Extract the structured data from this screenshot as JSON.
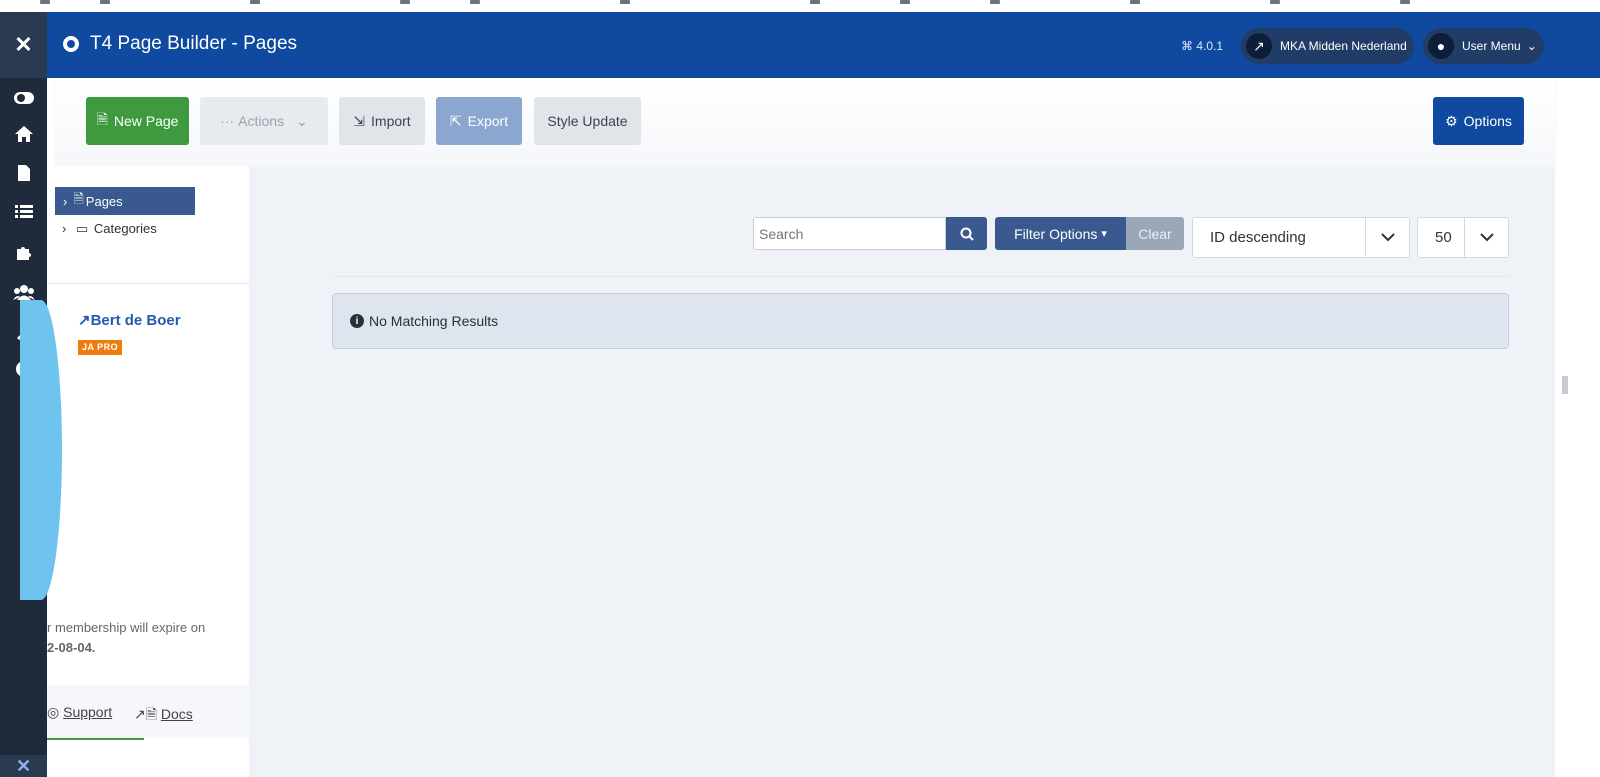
{
  "header": {
    "title": "T4 Page Builder - Pages",
    "version": "4.0.1",
    "site_link": "MKA Midden Nederland",
    "user_menu": "User Menu"
  },
  "toolbar": {
    "new_page": "New Page",
    "actions": "Actions",
    "import": "Import",
    "export": "Export",
    "style_update": "Style Update",
    "options": "Options"
  },
  "sidebar": {
    "tree": [
      {
        "label": "Pages",
        "selected": true
      },
      {
        "label": "Categories",
        "selected": false
      }
    ],
    "profile": {
      "name": "Bert de Boer",
      "badge": "JA PRO",
      "membership_line1": "r membership will expire on",
      "membership_line2": "2-08-04."
    },
    "links": {
      "support": "Support",
      "docs": "Docs"
    }
  },
  "filters": {
    "search_placeholder": "Search",
    "filter_options": "Filter Options",
    "clear": "Clear",
    "sort": "ID descending",
    "limit": "50"
  },
  "results": {
    "message": "No Matching Results"
  },
  "colors": {
    "header": "#0f4aa0",
    "rail": "#1f2a3a",
    "new_page_button": "#3e9a3f",
    "badge": "#f07c10"
  }
}
